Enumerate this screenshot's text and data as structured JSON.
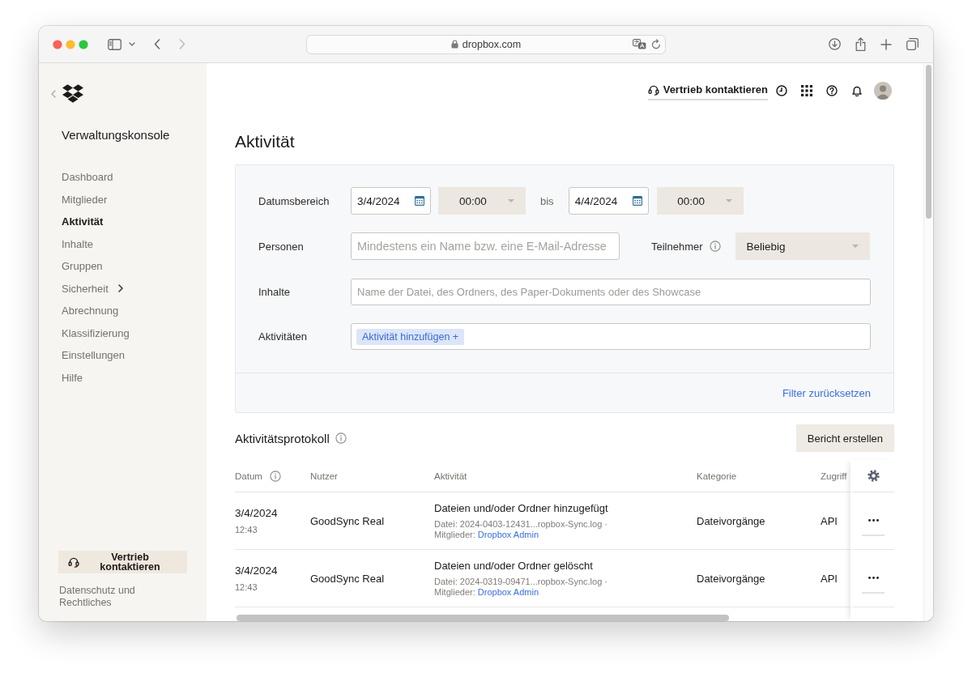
{
  "browser": {
    "url": "dropbox.com"
  },
  "sidebar": {
    "title": "Verwaltungskonsole",
    "items": [
      {
        "label": "Dashboard",
        "kind": "link",
        "selected": false
      },
      {
        "label": "Mitglieder",
        "kind": "link",
        "selected": false
      },
      {
        "label": "Aktivität",
        "kind": "link",
        "selected": true
      },
      {
        "label": "Inhalte",
        "kind": "link",
        "selected": false
      },
      {
        "label": "Gruppen",
        "kind": "link",
        "selected": false
      },
      {
        "label": "Sicherheit",
        "kind": "submenu",
        "selected": false
      },
      {
        "label": "Abrechnung",
        "kind": "link",
        "selected": false
      },
      {
        "label": "Klassifizierung",
        "kind": "link",
        "selected": false
      },
      {
        "label": "Einstellungen",
        "kind": "link",
        "selected": false
      },
      {
        "label": "Hilfe",
        "kind": "link",
        "selected": false
      }
    ],
    "contact_button": "Vertrieb kontaktieren",
    "footer_link": "Datenschutz und Rechtliches"
  },
  "header": {
    "contact_link": "Vertrieb kontaktieren"
  },
  "page_title": "Aktivität",
  "filters": {
    "date_range": {
      "label": "Datumsbereich",
      "from": {
        "date": "3/4/2024",
        "time": "00:00"
      },
      "separator": "bis",
      "to": {
        "date": "4/4/2024",
        "time": "00:00"
      }
    },
    "people": {
      "label": "Personen",
      "placeholder": "Mindestens ein Name bzw. eine E-Mail-Adresse",
      "participants": {
        "label": "Teilnehmer",
        "value": "Beliebig"
      }
    },
    "content": {
      "label": "Inhalte",
      "placeholder": "Name der Datei, des Ordners, des Paper-Dokuments oder des Showcase"
    },
    "activities": {
      "label": "Aktivitäten",
      "add_chip": "Aktivität hinzufügen +"
    },
    "reset_link": "Filter zurücksetzen"
  },
  "activity_log": {
    "title": "Aktivitätsprotokoll",
    "report_button": "Bericht erstellen",
    "columns": [
      {
        "label": "Datum",
        "info": true
      },
      {
        "label": "Nutzer",
        "info": false
      },
      {
        "label": "Aktivität",
        "info": false
      },
      {
        "label": "Kategorie",
        "info": false
      },
      {
        "label": "Zugriff",
        "info": false
      }
    ],
    "rows": [
      {
        "date": "3/4/2024",
        "time": "12:43",
        "user": "GoodSync Real",
        "activity": "Dateien und/oder Ordner hinzugefügt",
        "file": "Datei: 2024-0403-12431...ropbox-Sync.log ·",
        "members_label": "Mitglieder:",
        "member": "Dropbox Admin",
        "category": "Dateivorgänge",
        "access": "API"
      },
      {
        "date": "3/4/2024",
        "time": "12:43",
        "user": "GoodSync Real",
        "activity": "Dateien und/oder Ordner gelöscht",
        "file": "Datei: 2024-0319-09471...ropbox-Sync.log ·",
        "members_label": "Mitglieder:",
        "member": "Dropbox Admin",
        "category": "Dateivorgänge",
        "access": "API"
      }
    ]
  }
}
